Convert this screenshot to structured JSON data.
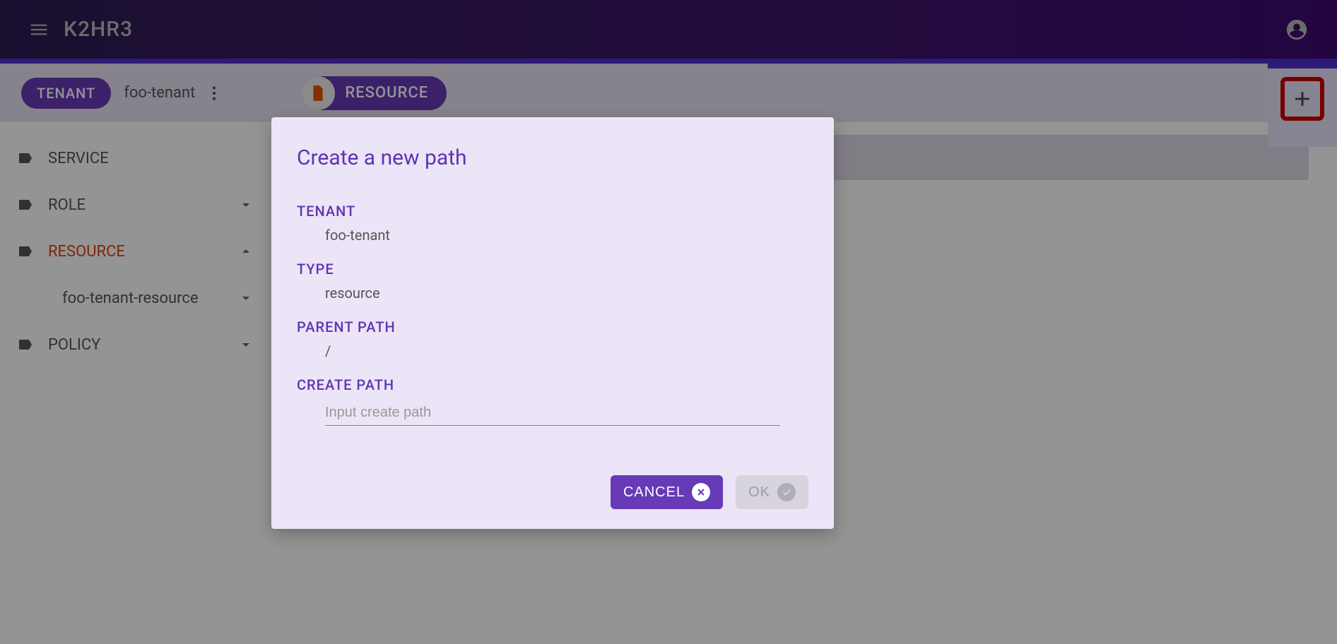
{
  "header": {
    "title": "K2HR3"
  },
  "toolbar": {
    "tenant_chip": "TENANT",
    "tenant_name": "foo-tenant",
    "resource_chip": "RESOURCE"
  },
  "sidebar": {
    "items": [
      {
        "label": "SERVICE"
      },
      {
        "label": "ROLE"
      },
      {
        "label": "RESOURCE"
      },
      {
        "label": "foo-tenant-resource"
      },
      {
        "label": "POLICY"
      }
    ]
  },
  "dialog": {
    "title": "Create a new path",
    "tenant_label": "TENANT",
    "tenant_value": "foo-tenant",
    "type_label": "TYPE",
    "type_value": "resource",
    "parent_label": "PARENT PATH",
    "parent_value": "/",
    "create_label": "CREATE PATH",
    "create_placeholder": "Input create path",
    "cancel": "CANCEL",
    "ok": "OK"
  }
}
